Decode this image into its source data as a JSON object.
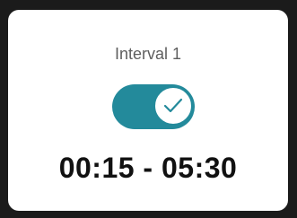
{
  "interval": {
    "title": "Interval 1",
    "enabled": true,
    "time_range": "00:15 - 05:30"
  },
  "colors": {
    "background": "#1b1b1b",
    "card": "#ffffff",
    "toggle_on": "#238a9b",
    "title_text": "#5e5e5e",
    "time_text": "#111111"
  },
  "icons": {
    "toggle_knob": "check-icon"
  }
}
